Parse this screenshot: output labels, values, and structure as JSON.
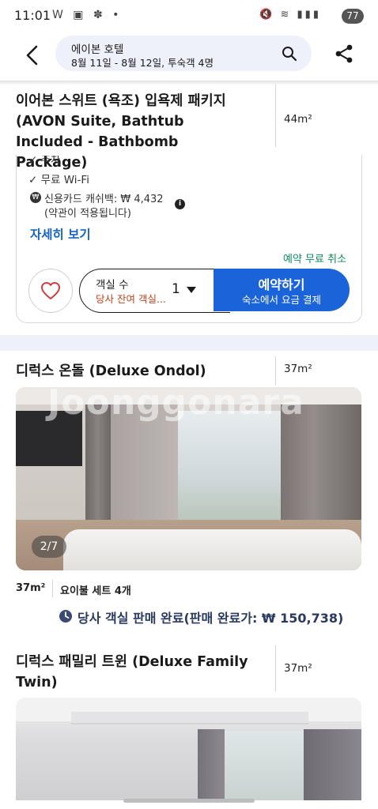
{
  "status": {
    "time": "11:01",
    "notif_icons": "W ▣ ✽ •",
    "sys_icons": "🔇 ≋ ▮▮▮",
    "battery": "77"
  },
  "search": {
    "hotel_name": "에이본 호텔",
    "dates_guests": "8월 11일 - 8월 12일, 투숙객 4명"
  },
  "room1": {
    "title": "이어본 스위트 (욕조) 입욕제 패키지 (AVON Suite, Bathtub Included - Bathbomb Package)",
    "area": "44m²",
    "amenity_cut": "주차",
    "amenity_wifi": "무료 Wi-Fi",
    "cashback_line1": "신용카드 캐쉬백: ₩ 4,432",
    "cashback_line2": "(약관이 적용됩니다)",
    "details_link": "자세히 보기",
    "free_cancel": "예약 무료 취소",
    "rooms_label": "객실 수",
    "rooms_remaining": "당사 잔여 객실...",
    "rooms_count": "1",
    "book_label": "예약하기",
    "book_sub": "숙소에서 요금 결제"
  },
  "room2": {
    "title": "디럭스 온돌 (Deluxe Ondol)",
    "area": "37m²",
    "photo_counter": "2/7",
    "watermark": "Joonggonara",
    "detail_area": "37m²",
    "detail_bedding": "요이불 세트 4개",
    "sold_out": "당사 객실 판매 완료(판매 완료가: ₩ 150,738)"
  },
  "room3": {
    "title": "디럭스 패밀리 트윈 (Deluxe Family Twin)",
    "area": "37m²"
  },
  "colors": {
    "primary": "#1a63d8",
    "link": "#1664c0",
    "free_cancel": "#0d8a5a",
    "heart": "#d23b3b"
  }
}
